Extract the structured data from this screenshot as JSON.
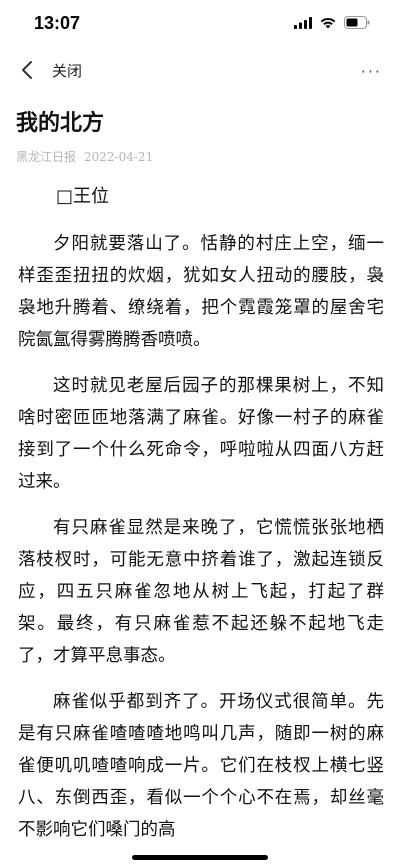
{
  "status_bar": {
    "time": "13:07",
    "icons": [
      "signal-icon",
      "wifi-icon",
      "battery-icon"
    ]
  },
  "nav": {
    "back_icon": "chevron-left-icon",
    "close_label": "关闭",
    "more_label": "···"
  },
  "article": {
    "title": "我的北方",
    "source": "黑龙江日报",
    "date": "2022-04-21",
    "author": "□王位",
    "paragraphs": [
      "夕阳就要落山了。恬静的村庄上空，缅一样歪歪扭扭的炊烟，犹如女人扭动的腰肢，袅袅地升腾着、缭绕着，把个霓霞笼罩的屋舍宅院氤氲得雾腾腾香喷喷。",
      "这时就见老屋后园子的那棵果树上，不知啥时密匝匝地落满了麻雀。好像一村子的麻雀接到了一个什么死命令，呼啦啦从四面八方赶过来。",
      "有只麻雀显然是来晚了，它慌慌张张地栖落枝杈时，可能无意中挤着谁了，激起连锁反应，四五只麻雀忽地从树上飞起，打起了群架。最终，有只麻雀惹不起还躲不起地飞走了，才算平息事态。",
      "麻雀似乎都到齐了。开场仪式很简单。先是有只麻雀喳喳喳地鸣叫几声，随即一树的麻雀便叽叽喳喳响成一片。它们在枝杈上横七竖八、东倒西歪，看似一个个心不在焉，却丝毫不影响它们嗓门的高"
    ]
  }
}
